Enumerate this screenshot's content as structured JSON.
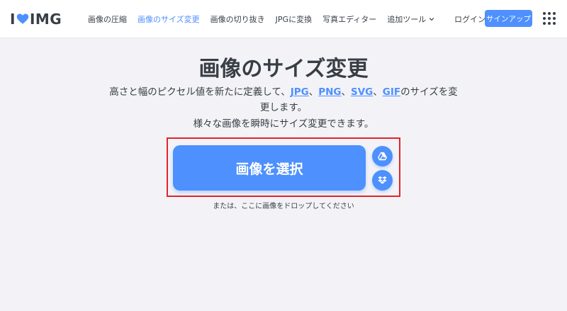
{
  "header": {
    "logo_left": "I",
    "logo_right": "IMG",
    "nav": [
      {
        "label": "画像の圧縮",
        "active": false
      },
      {
        "label": "画像のサイズ変更",
        "active": true
      },
      {
        "label": "画像の切り抜き",
        "active": false
      },
      {
        "label": "JPGに変換",
        "active": false
      },
      {
        "label": "写真エディター",
        "active": false
      },
      {
        "label": "追加ツール",
        "active": false
      }
    ],
    "login": "ログイン",
    "signup": "サインアップ"
  },
  "main": {
    "title": "画像のサイズ変更",
    "desc_prefix": "高さと幅のピクセル値を新たに定義して、",
    "formats": [
      "JPG",
      "PNG",
      "SVG",
      "GIF"
    ],
    "sep": "、",
    "desc_suffix": "のサイズを変更します。",
    "desc_line2": "様々な画像を瞬時にサイズ変更できます。",
    "select_button": "画像を選択",
    "drop_hint": "または、ここに画像をドロップしてください"
  },
  "icons": {
    "logo_heart": "heart-icon",
    "more_tools": "chevron-down-icon",
    "apps": "grid-icon",
    "google_drive": "google-drive-icon",
    "dropbox": "dropbox-icon"
  },
  "colors": {
    "accent": "#4d90fe",
    "text": "#383e45",
    "highlight": "#e3242b",
    "background": "#f3f3f7"
  }
}
